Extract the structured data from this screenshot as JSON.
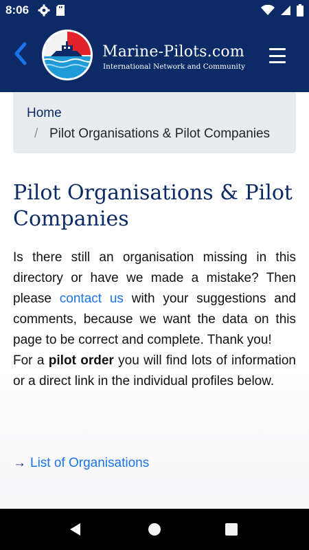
{
  "status_bar": {
    "time": "8:06",
    "left_icons": [
      "gear-icon",
      "sd-card-icon"
    ],
    "right_icons": [
      "wifi-icon",
      "signal-icon",
      "battery-icon"
    ]
  },
  "header": {
    "brand_name": "Marine-Pilots.com",
    "tagline": "International Network and Community",
    "colors": {
      "background": "#0b2a66",
      "text": "#ffffff"
    }
  },
  "breadcrumb": {
    "home": "Home",
    "separator": "/",
    "current": "Pilot Organisations & Pilot Companies"
  },
  "page": {
    "title": "Pilot Organisations & Pilot Companies",
    "intro_part1": "Is there still an organisation missing in this directory or have we made a mistake? Then please ",
    "contact_link": "contact us",
    "intro_part2": " with your suggestions and comments, because we want the data on this page to be correct and complete. Thank you!",
    "order_part1": "For a ",
    "order_bold": "pilot order",
    "order_part2": " you will find lots of information or a direct link in the individual profiles below.",
    "org_link_arrow": "→",
    "org_link_label": "List of Organisations",
    "colors": {
      "heading": "#0b2a66",
      "link": "#1a73e8"
    }
  },
  "nav_bar": {
    "icons": [
      "back-icon",
      "home-icon",
      "recents-icon"
    ]
  }
}
